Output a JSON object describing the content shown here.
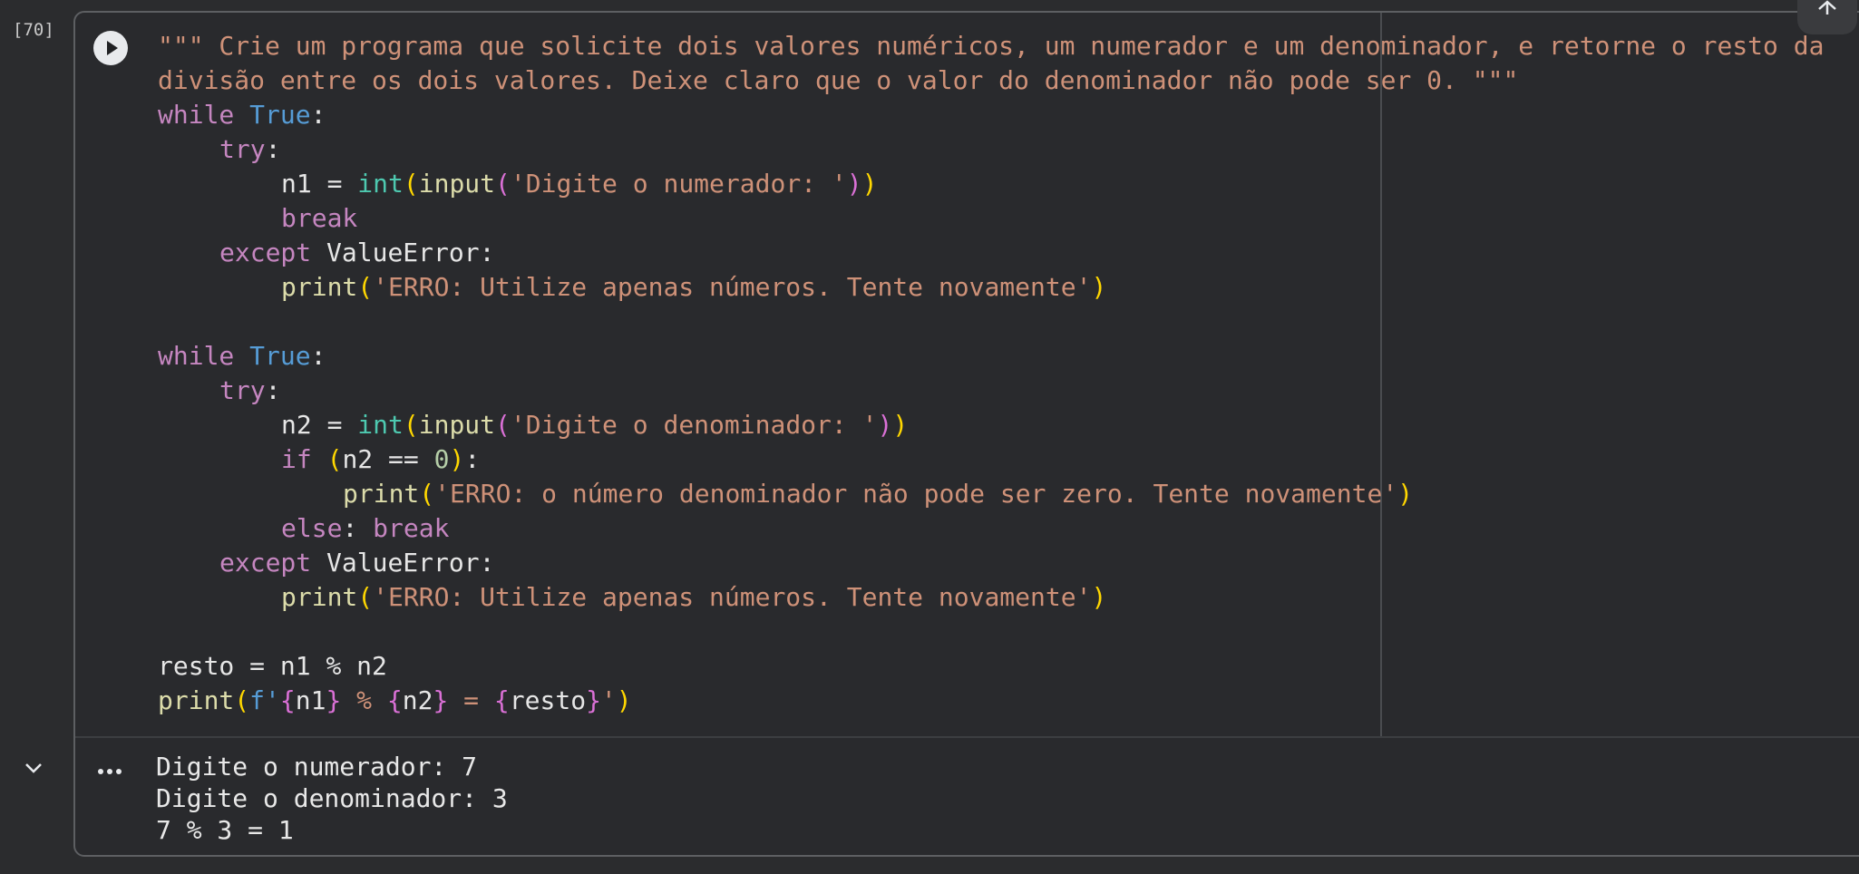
{
  "cell": {
    "execution_count": "[70]",
    "code_lines": [
      "\"\"\" Crie um programa que solicite dois valores numéricos, um numerador e um denominador, e retorne o resto da",
      "divisão entre os dois valores. Deixe claro que o valor do denominador não pode ser 0. \"\"\"",
      "while True:",
      "    try:",
      "        n1 = int(input('Digite o numerador: '))",
      "        break",
      "    except ValueError:",
      "        print('ERRO: Utilize apenas números. Tente novamente')",
      "",
      "while True:",
      "    try:",
      "        n2 = int(input('Digite o denominador: '))",
      "        if (n2 == 0):",
      "            print('ERRO: o número denominador não pode ser zero. Tente novamente')",
      "        else: break",
      "    except ValueError:",
      "        print('ERRO: Utilize apenas números. Tente novamente')",
      "",
      "resto = n1 % n2",
      "print(f'{n1} % {n2} = {resto}')"
    ]
  },
  "tokens": {
    "l1_doc": "\"\"\" Crie um programa que solicite dois valores numéricos, um numerador e um denominador, e retorne o resto da",
    "l2_doc": "divisão entre os dois valores. Deixe claro que o valor do denominador não pode ser 0. \"\"\"",
    "kw_while": "while",
    "const_true": "True",
    "colon": ":",
    "kw_try": "try",
    "var_n1": "n1",
    "var_n2": "n2",
    "assign": " = ",
    "fn_int": "int",
    "fn_input": "input",
    "fn_print": "print",
    "paren_open": "(",
    "paren_close": ")",
    "str_numerador": "'Digite o numerador: '",
    "str_denominador": "'Digite o denominador: '",
    "kw_break": "break",
    "kw_except": "except",
    "cls_valueerror": " ValueError",
    "str_erro_numeros": "'ERRO: Utilize apenas números. Tente novamente'",
    "kw_if": "if",
    "op_eq": " == ",
    "num_zero": "0",
    "str_erro_zero": "'ERRO: o número denominador não pode ser zero. Tente novamente'",
    "kw_else": "else",
    "colon_space": ": ",
    "var_resto": "resto",
    "mod_expr": " = n1 % n2",
    "fprefix": "f'",
    "brace_open": "{",
    "brace_close": "}",
    "var_n1_plain": "n1",
    "var_n2_plain": "n2",
    "fstr_pct": " % ",
    "fstr_eq": " = ",
    "fstr_end": "'"
  },
  "output": {
    "lines": [
      "Digite o numerador: 7",
      "Digite o denominador: 3",
      "7 % 3 = 1"
    ]
  },
  "icons": {
    "run": "play-circle-icon",
    "collapse": "chevron-down-icon",
    "more": "more-horizontal-icon",
    "scroll_top": "arrow-up-icon"
  },
  "colors": {
    "background": "#2b2c2e",
    "string": "#ce9178",
    "keyword": "#c586c0",
    "constant": "#569cd6",
    "function": "#dcdcaa",
    "class": "#4ec9b0",
    "number": "#b5cea8",
    "bracket_level1": "#ffd700",
    "bracket_level2": "#da70d6"
  }
}
